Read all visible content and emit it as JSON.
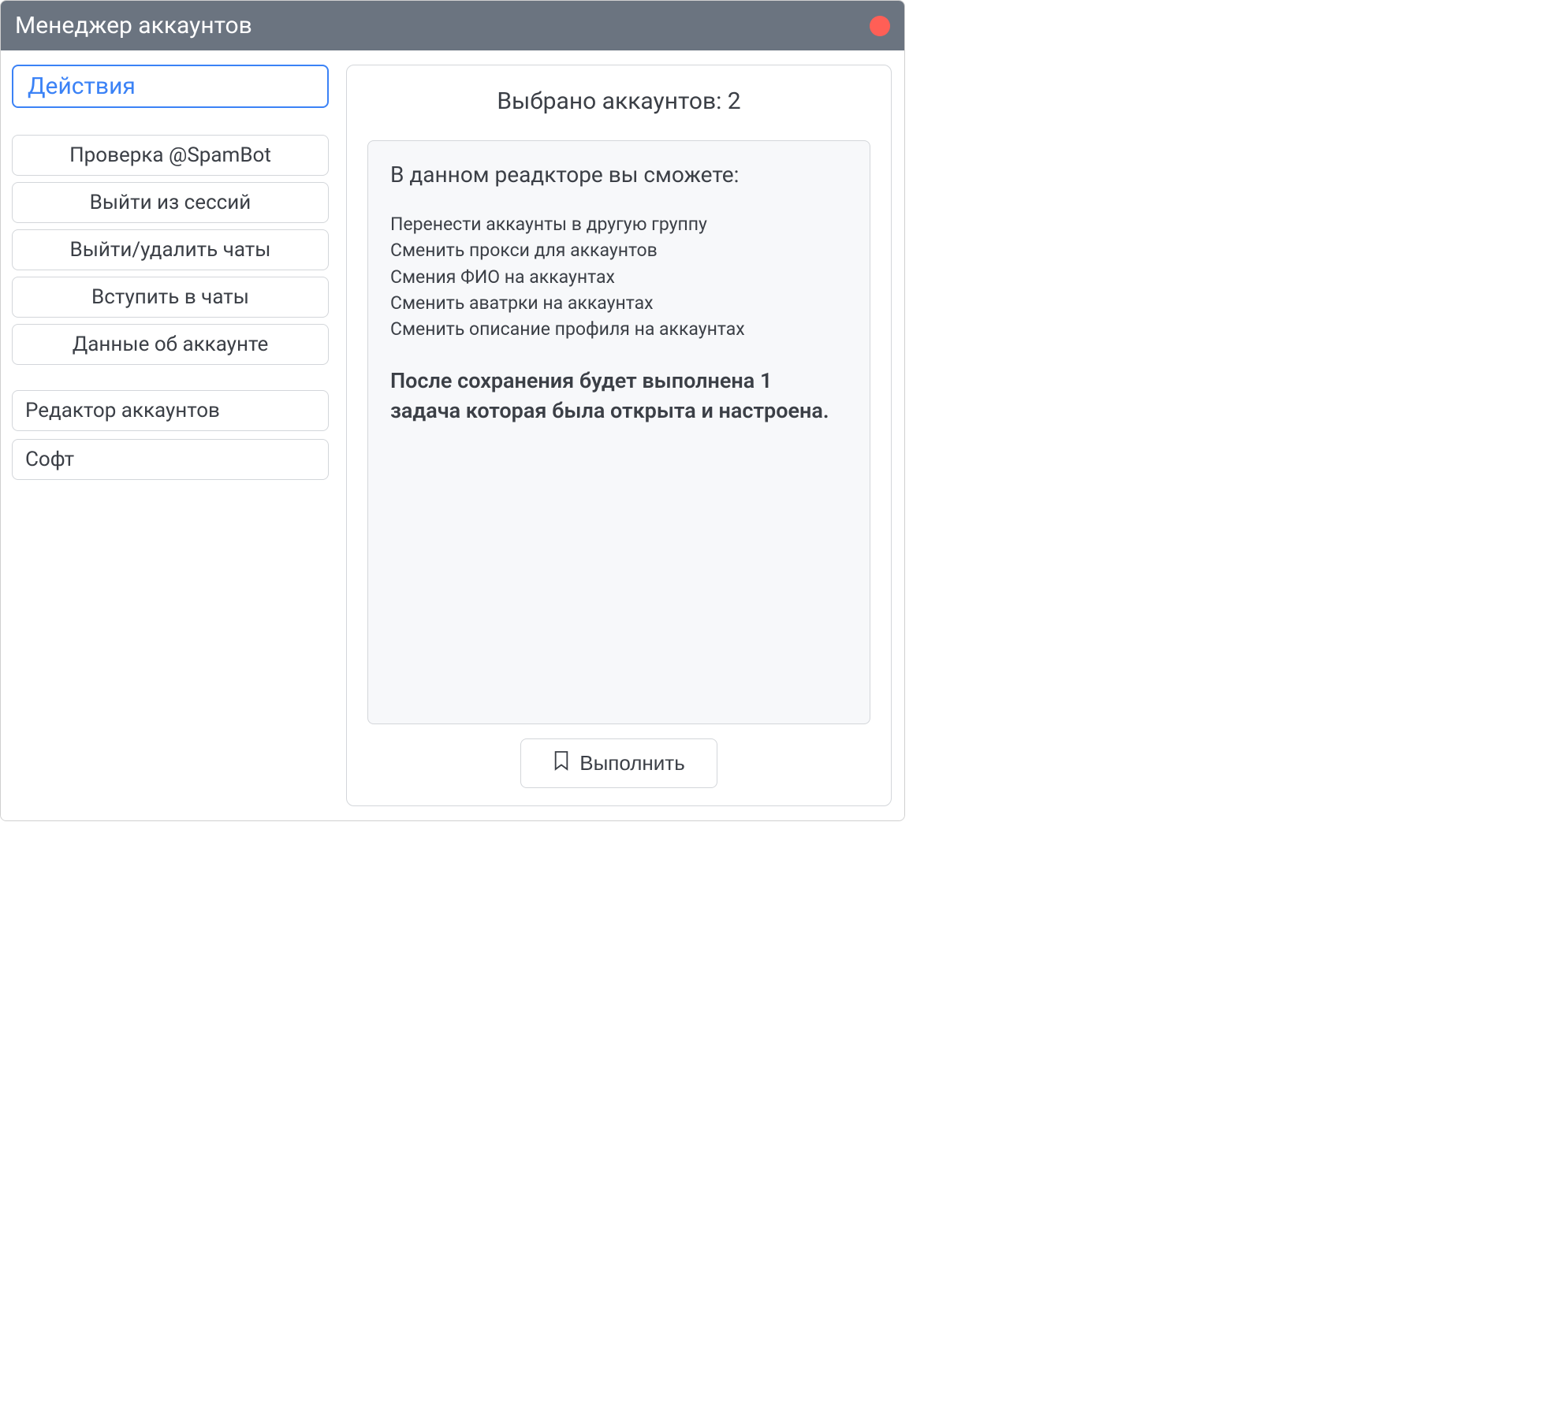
{
  "window": {
    "title": "Менеджер аккаунтов"
  },
  "sidebar": {
    "header": "Действия",
    "actions": [
      "Проверка @SpamBot",
      "Выйти из сессий",
      "Выйти/удалить чаты",
      "Вступить в чаты",
      "Данные об аккаунте"
    ],
    "editor": "Редактор аккаунтов",
    "soft": "Софт"
  },
  "main": {
    "selected_label": "Выбрано аккаунтов: 2",
    "info_lead": "В данном реадкторе вы сможете:",
    "info_items": [
      "Перенести аккаунты в другую группу",
      "Сменить прокси для аккаунтов",
      "Смения ФИО на аккаунтах",
      "Сменить аватрки на аккаунтах",
      "Сменить описание профиля на аккаунтах"
    ],
    "info_note": "После сохранения будет выполнена 1 задача которая была открыта и настроена.",
    "execute_label": "Выполнить"
  }
}
